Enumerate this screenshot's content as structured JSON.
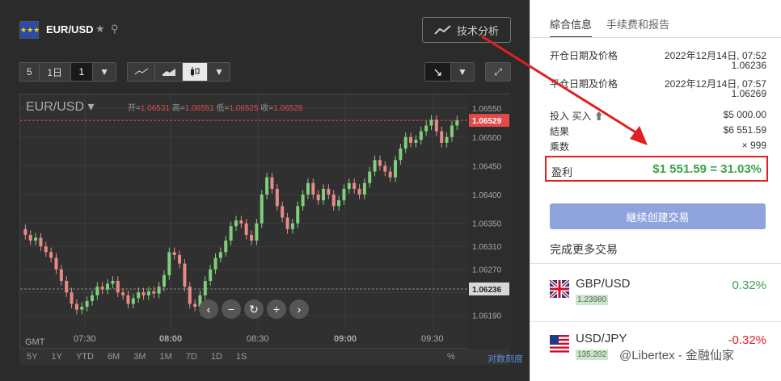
{
  "header": {
    "pair": "EUR/USD",
    "ta_button": "技术分析",
    "icons": [
      "eu-flag-icon",
      "star-icon",
      "search-icon",
      "chart-trend-icon"
    ]
  },
  "toolbar": {
    "chart_count": "5",
    "timeframe": "1日",
    "interval": "1",
    "trade_direction_icon": "arrow-down-right-icon",
    "chart_types": [
      "line-chart-icon",
      "area-chart-icon",
      "candle-chart-icon"
    ]
  },
  "chart": {
    "symbol": "EUR/USD",
    "ohlc_open_label": "开=",
    "ohlc_open": "1.06531",
    "ohlc_high_label": "高=",
    "ohlc_high": "1.06551",
    "ohlc_low_label": "低=",
    "ohlc_low": "1.06525",
    "ohlc_close_label": "收=",
    "ohlc_close": "1.06529",
    "current_price": "1.06529",
    "open_price": "1.06236",
    "gmt_label": "GMT",
    "percent_label": "%",
    "log_scale_label": "对数刻度",
    "periods": [
      "5Y",
      "1Y",
      "YTD",
      "6M",
      "3M",
      "1M",
      "7D",
      "1D",
      "1S"
    ]
  },
  "chart_data": {
    "type": "candlestick",
    "y_ticks": [
      "1.06550",
      "1.06500",
      "1.06450",
      "1.06400",
      "1.06350",
      "1.06310",
      "1.06270",
      "1.06230",
      "1.06190"
    ],
    "x_ticks": [
      "07:30",
      "08:00",
      "08:30",
      "09:00",
      "09:30"
    ],
    "ylim": [
      1.0617,
      1.0656
    ],
    "grid": true
  },
  "right": {
    "tabs": [
      "綜合信息",
      "手续费和报告"
    ],
    "open_date_label": "开仓日期及价格",
    "open_date": "2022年12月14日, 07:52",
    "open_price": "1.06236",
    "close_date_label": "平仓日期及价格",
    "close_date": "2022年12月14日, 07:57",
    "close_price": "1.06269",
    "invest_label": "投入",
    "invest_dir": "买入",
    "invest_value": "$5 000.00",
    "result_label": "結果",
    "result_value": "$6 551.59",
    "multiplier_label": "乘数",
    "multiplier_value": "× 999",
    "profit_label": "盈利",
    "profit_value": "$1 551.59  =  31.03%",
    "continue_button": "継续创建交易",
    "more_trades_title": "完成更多交易",
    "trades": [
      {
        "symbol": "GBP/USD",
        "price": "1.23980",
        "change": "0.32%",
        "color": "#3aa34b"
      },
      {
        "symbol": "USD/JPY",
        "price": "135.202",
        "change": "-0.32%",
        "color": "#e02020"
      }
    ],
    "watermark": "@Libertex - 金融仙家"
  }
}
